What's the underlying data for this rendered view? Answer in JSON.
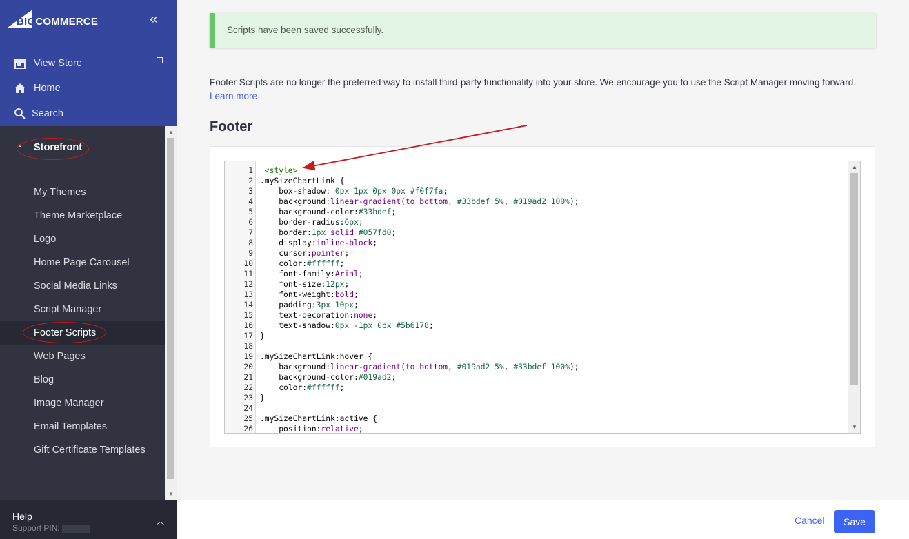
{
  "brand": {
    "logo_text_a": "BIG",
    "logo_text_b": "COMMERCE",
    "collapse_icon": "double-chevron-left-icon",
    "primary_color": "#34469d",
    "accent_color": "#3c64f4"
  },
  "top_nav": {
    "view_store": "View Store",
    "home": "Home",
    "search": "Search"
  },
  "sidebar": {
    "section_title": "Storefront",
    "items": [
      {
        "label": "My Themes"
      },
      {
        "label": "Theme Marketplace"
      },
      {
        "label": "Logo"
      },
      {
        "label": "Home Page Carousel"
      },
      {
        "label": "Social Media Links"
      },
      {
        "label": "Script Manager"
      },
      {
        "label": "Footer Scripts",
        "active": true
      },
      {
        "label": "Web Pages"
      },
      {
        "label": "Blog"
      },
      {
        "label": "Image Manager"
      },
      {
        "label": "Email Templates"
      },
      {
        "label": "Gift Certificate Templates"
      }
    ]
  },
  "help": {
    "title": "Help",
    "pin_label": "Support PIN:"
  },
  "alert": {
    "message": "Scripts have been saved successfully."
  },
  "intro": {
    "text": "Footer Scripts are no longer the preferred way to install third-party functionality into your store. We encourage you to use the Script Manager moving forward.",
    "link": "Learn more"
  },
  "editor": {
    "heading": "Footer",
    "lines": [
      " <style>",
      ".mySizeChartLink {",
      "    box-shadow: 0px 1px 0px 0px #f0f7fa;",
      "    background:linear-gradient(to bottom, #33bdef 5%, #019ad2 100%);",
      "    background-color:#33bdef;",
      "    border-radius:6px;",
      "    border:1px solid #057fd0;",
      "    display:inline-block;",
      "    cursor:pointer;",
      "    color:#ffffff;",
      "    font-family:Arial;",
      "    font-size:12px;",
      "    font-weight:bold;",
      "    padding:3px 10px;",
      "    text-decoration:none;",
      "    text-shadow:0px -1px 0px #5b6178;",
      "}",
      "",
      ".mySizeChartLink:hover {",
      "    background:linear-gradient(to bottom, #019ad2 5%, #33bdef 100%);",
      "    background-color:#019ad2;",
      "    color:#ffffff;",
      "}",
      "",
      ".mySizeChartLink:active {",
      "    position:relative;"
    ]
  },
  "actions": {
    "cancel": "Cancel",
    "save": "Save"
  }
}
